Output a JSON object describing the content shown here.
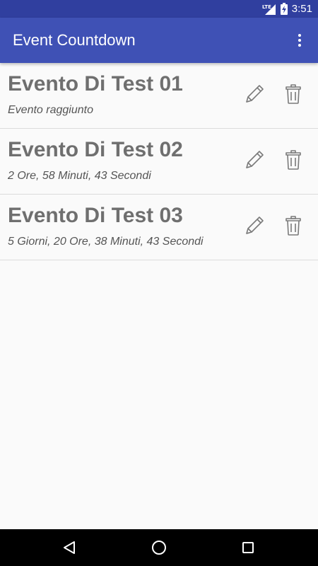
{
  "status_bar": {
    "time": "3:51",
    "network_label": "LTE",
    "icons": [
      "lte-signal-icon",
      "battery-charging-icon"
    ]
  },
  "app_bar": {
    "title": "Event Countdown",
    "menu_icon": "more-vert-icon",
    "background": "#3f51b5",
    "status_background": "#303f9f"
  },
  "events": [
    {
      "title": "Evento Di Test 01",
      "countdown": "Evento raggiunto",
      "edit_icon": "pencil-icon",
      "delete_icon": "trash-icon"
    },
    {
      "title": "Evento Di Test 02",
      "countdown": "2 Ore, 58 Minuti, 43 Secondi",
      "edit_icon": "pencil-icon",
      "delete_icon": "trash-icon"
    },
    {
      "title": "Evento Di Test 03",
      "countdown": "5 Giorni, 20 Ore, 38 Minuti, 43 Secondi",
      "edit_icon": "pencil-icon",
      "delete_icon": "trash-icon"
    }
  ],
  "nav_bar": {
    "icons": [
      "back-icon",
      "home-icon",
      "recents-icon"
    ]
  }
}
